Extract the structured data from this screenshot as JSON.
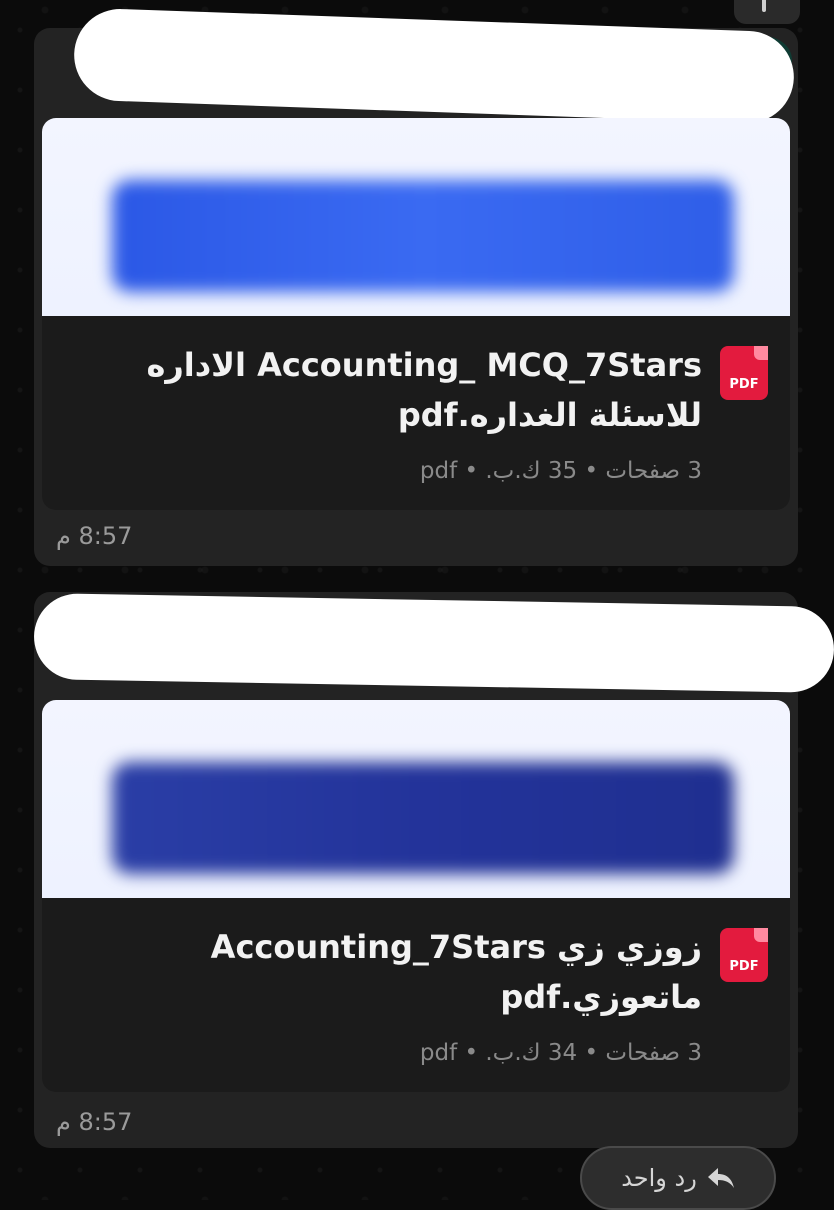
{
  "messages": [
    {
      "file_name": "Accounting_ MCQ_7Stars الاداره للاسئلة الغداره.pdf",
      "meta": "3 صفحات • 35 ك.ب. • pdf",
      "time": "8:57 م"
    },
    {
      "file_name": "زوزي زي Accounting_7Stars ماتعوزي.pdf",
      "meta": "3 صفحات • 34 ك.ب. • pdf",
      "time": "8:57 م"
    }
  ],
  "pdf_badge": "PDF",
  "reply_button": {
    "label": "رد واحد",
    "icon": "reply-arrow-icon"
  },
  "colors": {
    "pdf_red": "#e31b3e",
    "bubble": "#232323",
    "card": "#1b1b1b",
    "background": "#0b0b0b"
  }
}
